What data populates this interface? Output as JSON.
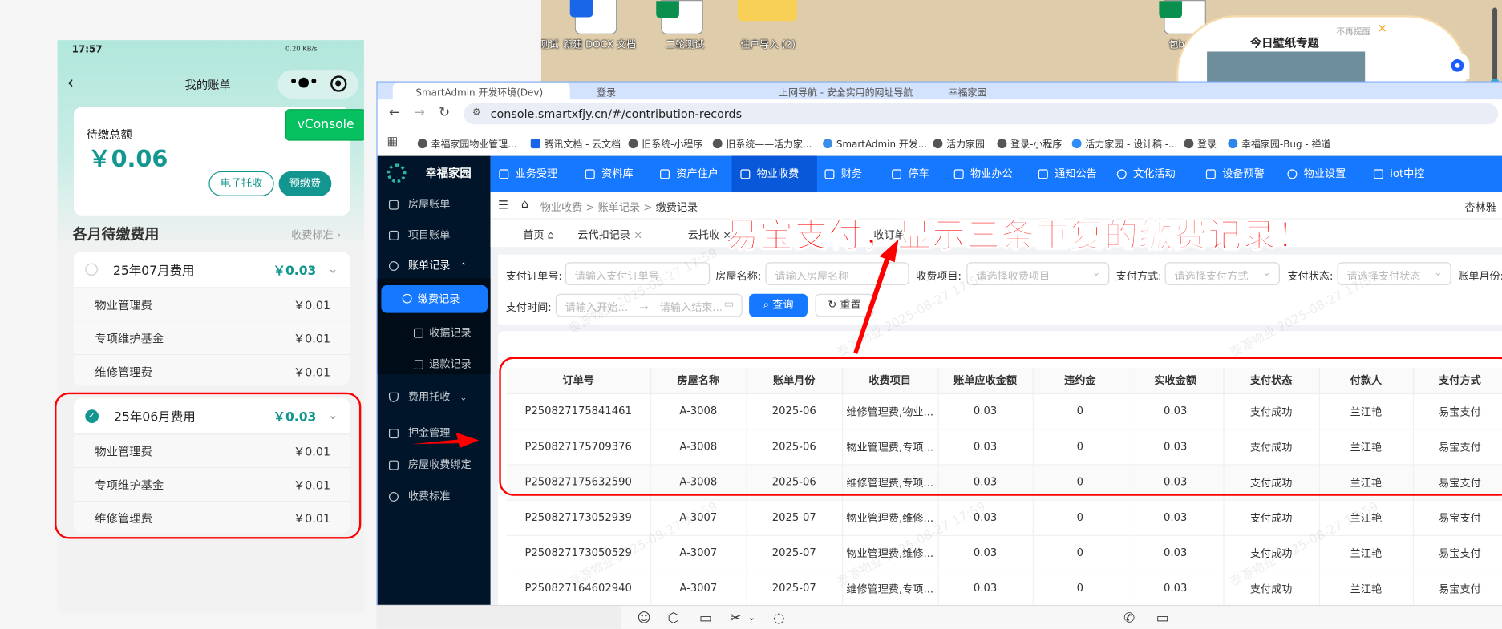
{
  "desktop": {
    "icons": [
      "测试",
      "新建 DOCX 文档",
      "二轮测试",
      "住户导入 (2)",
      "包bug"
    ],
    "popup": {
      "title": "今日壁纸专题",
      "dismiss": "不再提醒"
    }
  },
  "phone": {
    "status_time": "17:57",
    "status_speed": "0.20 KB/s",
    "title": "我的账单",
    "total_label": "待缴总额",
    "total_amount": "￥0.06",
    "btn_auto": "电子托收",
    "btn_prepay": "预缴费",
    "vconsole": "vConsole",
    "section_title": "各月待缴费用",
    "standard_link": "收费标准",
    "months": [
      {
        "label": "25年07月费用",
        "amount": "￥0.03",
        "checked": false,
        "items": [
          {
            "name": "物业管理费",
            "amount": "￥0.01"
          },
          {
            "name": "专项维护基金",
            "amount": "￥0.01"
          },
          {
            "name": "维修管理费",
            "amount": "￥0.01"
          }
        ]
      },
      {
        "label": "25年06月费用",
        "amount": "￥0.03",
        "checked": true,
        "items": [
          {
            "name": "物业管理费",
            "amount": "￥0.01"
          },
          {
            "name": "专项维护基金",
            "amount": "￥0.01"
          },
          {
            "name": "维修管理费",
            "amount": "￥0.01"
          }
        ]
      }
    ]
  },
  "browser": {
    "tabs": [
      "SmartAdmin 开发环境(Dev)",
      "登录",
      "上网导航 - 安全实用的网址导航",
      "幸福家园"
    ],
    "url": "console.smartxfjy.cn/#/contribution-records",
    "bookmarks": [
      "幸福家园物业管理...",
      "腾讯文档 - 云文档",
      "旧系统-小程序",
      "旧系统——活力家...",
      "SmartAdmin 开发...",
      "活力家园",
      "登录-小程序",
      "活力家园 - 设计稿 -...",
      "登录",
      "幸福家园-Bug - 禅道"
    ]
  },
  "app": {
    "logo": "幸福家园",
    "user": "杏林雅",
    "topnav": [
      "业务受理",
      "资料库",
      "资产住户",
      "物业收费",
      "财务",
      "停车",
      "物业办公",
      "通知公告",
      "文化活动",
      "设备预警",
      "物业设置",
      "iot中控"
    ],
    "sidebar": [
      "房屋账单",
      "项目账单",
      "账单记录",
      "缴费记录",
      "收据记录",
      "退款记录",
      "费用托收",
      "押金管理",
      "房屋收费绑定",
      "收费标准"
    ],
    "breadcrumb": [
      "物业收费",
      "账单记录",
      "缴费记录"
    ],
    "tabs": [
      "首页",
      "云代扣记录",
      "云托收",
      "收订单"
    ],
    "filters": {
      "order_label": "支付订单号:",
      "order_ph": "请输入支付订单号",
      "house_label": "房屋名称:",
      "house_ph": "请输入房屋名称",
      "item_label": "收费项目:",
      "item_ph": "请选择收费项目",
      "method_label": "支付方式:",
      "method_ph": "请选择支付方式",
      "status_label": "支付状态:",
      "status_ph": "请选择支付状态",
      "month_label": "账单月份:",
      "time_label": "支付时间:",
      "start_ph": "请输入开始...",
      "end_ph": "请输入结束...",
      "search": "查询",
      "reset": "重置"
    },
    "table": {
      "columns": [
        "订单号",
        "房屋名称",
        "账单月份",
        "收费项目",
        "账单应收金额",
        "违约金",
        "实收金额",
        "支付状态",
        "付款人",
        "支付方式"
      ],
      "rows": [
        [
          "P250827175841461",
          "A-3008",
          "2025-06",
          "维修管理费,物业...",
          "0.03",
          "0",
          "0.03",
          "支付成功",
          "兰江艳",
          "易宝支付"
        ],
        [
          "P250827175709376",
          "A-3008",
          "2025-06",
          "物业管理费,专项...",
          "0.03",
          "0",
          "0.03",
          "支付成功",
          "兰江艳",
          "易宝支付"
        ],
        [
          "P250827175632590",
          "A-3008",
          "2025-06",
          "维修管理费,专项...",
          "0.03",
          "0",
          "0.03",
          "支付成功",
          "兰江艳",
          "易宝支付"
        ],
        [
          "P250827173052939",
          "A-3007",
          "2025-07",
          "物业管理费,维修...",
          "0.03",
          "0",
          "0.03",
          "支付成功",
          "兰江艳",
          "易宝支付"
        ],
        [
          "P250827173050529",
          "A-3007",
          "2025-07",
          "物业管理费,维修...",
          "0.03",
          "0",
          "0.03",
          "支付成功",
          "兰江艳",
          "易宝支付"
        ],
        [
          "P250827164602940",
          "A-3007",
          "2025-07",
          "维修管理费,专项...",
          "0.03",
          "0",
          "0.03",
          "支付成功",
          "兰江艳",
          "易宝支付"
        ]
      ]
    },
    "watermark": "泰源物业 2025-08-27 17:59"
  },
  "annotation": "易宝支付，显示三条重复的缴费记录！",
  "colors": {
    "brand_blue": "#1677ff",
    "teal": "#13968f",
    "annotation_red": "#ff0000",
    "sidebar": "#001529"
  }
}
